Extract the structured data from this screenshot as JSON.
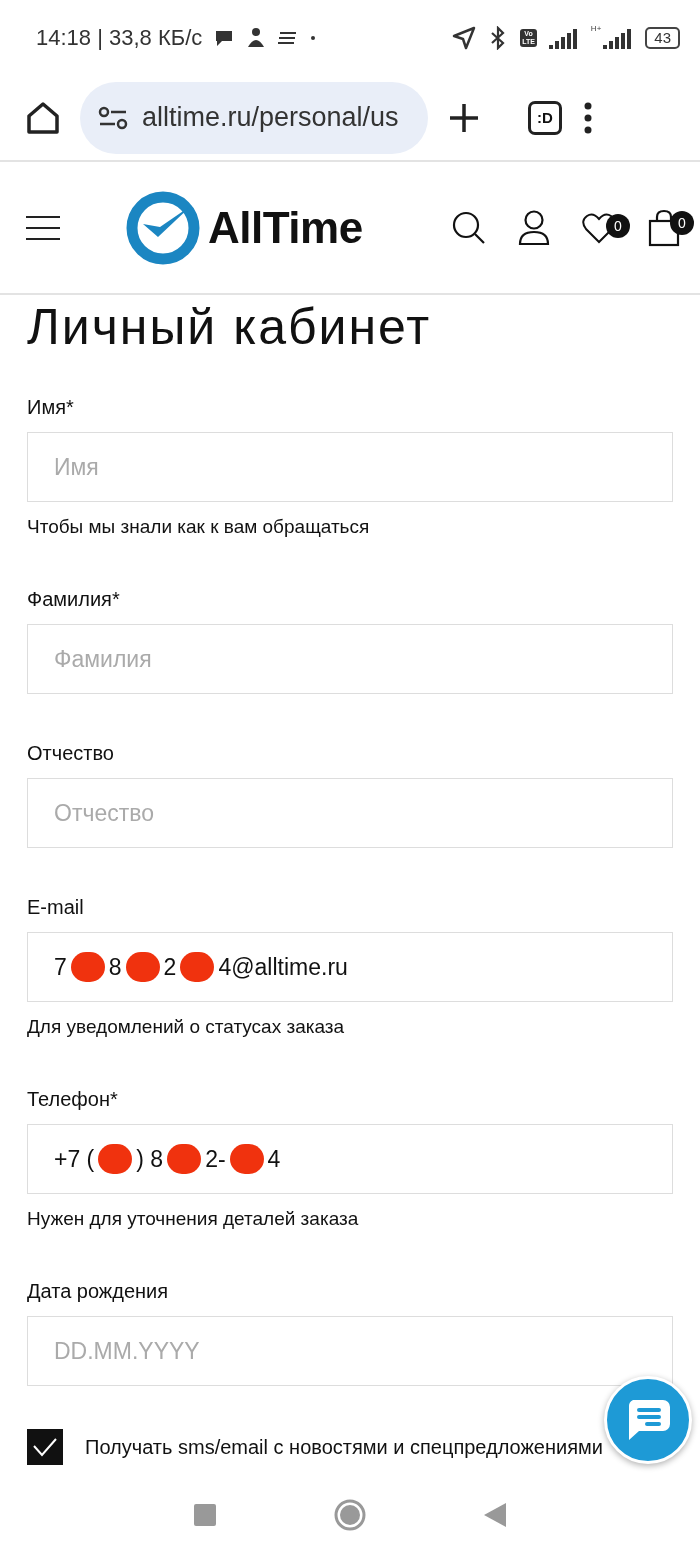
{
  "status_bar": {
    "time": "14:18 | 33,8 КБ/с",
    "volte": [
      "Vo",
      "LTE"
    ],
    "network": "H+",
    "battery": "43"
  },
  "browser": {
    "url": "alltime.ru/personal/us",
    "tabs_button": ":D"
  },
  "site_header": {
    "logo": "AllTime",
    "wishlist_count": "0",
    "cart_count": "0"
  },
  "title": "Личный кабинет",
  "fields": [
    {
      "label": "Имя*",
      "placeholder": "Имя",
      "hint": "Чтобы мы знали как к вам обращаться"
    },
    {
      "label": "Фамилия*",
      "placeholder": "Фамилия"
    },
    {
      "label": "Отчество",
      "placeholder": "Отчество"
    },
    {
      "label": "E-mail",
      "value": [
        {
          "kind": "text",
          "text": "7"
        },
        {
          "kind": "redacted"
        },
        {
          "kind": "text",
          "text": "8"
        },
        {
          "kind": "redacted"
        },
        {
          "kind": "text",
          "text": "2"
        },
        {
          "kind": "redacted"
        },
        {
          "kind": "text",
          "text": "4@alltime.ru"
        }
      ],
      "hint": "Для уведомлений о статусах заказа"
    },
    {
      "label": "Телефон*",
      "value": [
        {
          "kind": "text",
          "text": "+7 ("
        },
        {
          "kind": "redacted"
        },
        {
          "kind": "text",
          "text": ") 8"
        },
        {
          "kind": "redacted"
        },
        {
          "kind": "text",
          "text": "2-"
        },
        {
          "kind": "redacted"
        },
        {
          "kind": "text",
          "text": "4"
        }
      ],
      "hint": "Нужен для уточнения деталей заказа"
    },
    {
      "label": "Дата рождения",
      "placeholder": "DD.MM.YYYY"
    }
  ],
  "subscribe": {
    "checked": true,
    "label": "Получать sms/email с новостями и спецпредложениями"
  }
}
